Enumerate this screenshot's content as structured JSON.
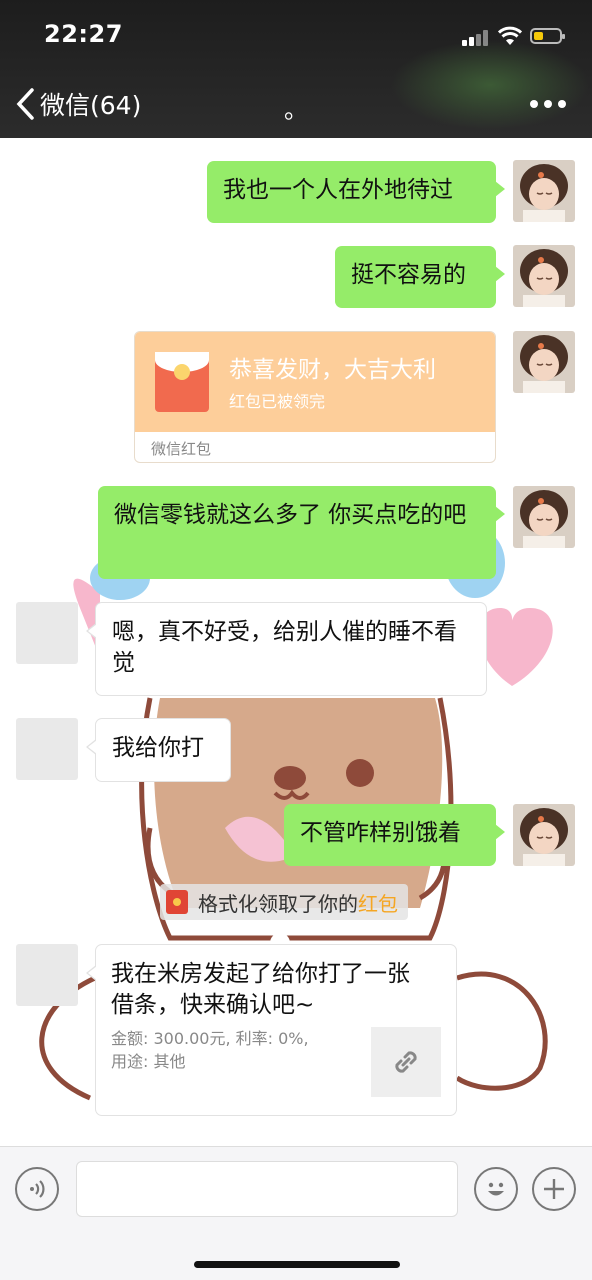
{
  "status_bar": {
    "time": "22:27"
  },
  "nav": {
    "back_label": "微信(64)",
    "title": "。"
  },
  "messages": [
    {
      "side": "me",
      "text": "我也一个人在外地待过"
    },
    {
      "side": "me",
      "text": "挺不容易的"
    },
    {
      "side": "me",
      "type": "red_packet",
      "title": "恭喜发财，大吉大利",
      "status": "红包已被领完",
      "footer": "微信红包"
    },
    {
      "side": "me",
      "text": "微信零钱就这么多了 你买点吃的吧"
    },
    {
      "side": "other",
      "text": "嗯，真不好受，给别人催的睡不看觉"
    },
    {
      "side": "other",
      "text": "我给你打"
    },
    {
      "side": "me",
      "text": "不管咋样别饿着"
    }
  ],
  "notice": {
    "text": "格式化领取了你的",
    "link": "红包"
  },
  "loan_card": {
    "title": "我在米房发起了给你打了一张借条，快来确认吧~",
    "detail_line1": "金额: 300.00元, 利率: 0%,",
    "detail_line2": "用途: 其他",
    "icon": "link-icon"
  },
  "input_bar": {
    "voice_icon": "voice-icon",
    "emoji_icon": "emoji-icon",
    "plus_icon": "plus-icon"
  },
  "colors": {
    "bubble_me": "#95ec69",
    "nav_bg": "#2a2a2a",
    "packet_bg": "#fdce9a",
    "link": "#f5a623"
  }
}
